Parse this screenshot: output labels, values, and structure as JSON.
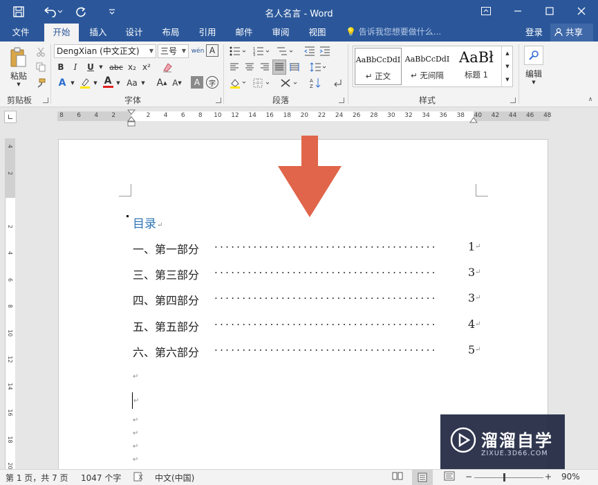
{
  "window": {
    "title": "名人名言 - Word"
  },
  "quick_access": {
    "save_icon": "save-icon",
    "undo_icon": "undo-icon",
    "redo_icon": "redo-icon",
    "customize_icon": "customize-qat-icon"
  },
  "window_controls": {
    "ribbon_display_icon": "ribbon-display-icon",
    "minimize_icon": "minimize-icon",
    "maximize_icon": "maximize-icon",
    "close_icon": "close-icon"
  },
  "tabs": [
    "文件",
    "开始",
    "插入",
    "设计",
    "布局",
    "引用",
    "邮件",
    "审阅",
    "视图"
  ],
  "active_tab": "开始",
  "tell_me": "告诉我您想要做什么...",
  "account": {
    "login": "登录",
    "share": "共享"
  },
  "ribbon": {
    "clipboard": {
      "label": "剪贴板",
      "paste": "粘贴"
    },
    "font": {
      "label": "字体",
      "font_name": "DengXian (中文正文)",
      "font_size": "三号",
      "phonetic_guide": "wén",
      "bold": "B",
      "italic": "I",
      "underline": "U",
      "strikethrough": "abc",
      "subscript": "x₂",
      "superscript": "x²",
      "change_case": "Aa",
      "grow_font": "A",
      "shrink_font": "A",
      "char_shading": "A",
      "enclose_char": "字"
    },
    "paragraph": {
      "label": "段落"
    },
    "styles": {
      "label": "样式",
      "items": [
        {
          "sample": "AaBbCcDdI",
          "name": "↵ 正文"
        },
        {
          "sample": "AaBbCcDdI",
          "name": "↵ 无间隔"
        },
        {
          "sample": "AaBł",
          "name": "标题 1"
        }
      ]
    },
    "editing": {
      "label": "编辑"
    }
  },
  "ruler": {
    "horizontal_numbers": [
      "8",
      "6",
      "4",
      "2",
      "",
      "2",
      "4",
      "6",
      "8",
      "10",
      "12",
      "14",
      "16",
      "18",
      "20",
      "22",
      "24",
      "26",
      "28",
      "30",
      "32",
      "34",
      "36",
      "38",
      "40",
      "42",
      "44",
      "46",
      "48"
    ],
    "vertical_numbers": [
      "4",
      "2",
      "",
      "2",
      "4",
      "6",
      "8",
      "10",
      "12",
      "14",
      "16",
      "18",
      "20"
    ]
  },
  "document": {
    "toc_title": "目录",
    "toc_entries": [
      {
        "text": "一、第一部分",
        "page": "1"
      },
      {
        "text": "三、第三部分",
        "page": "3"
      },
      {
        "text": "四、第四部分",
        "page": "3"
      },
      {
        "text": "五、第五部分",
        "page": "4"
      },
      {
        "text": "六、第六部分",
        "page": "5"
      }
    ],
    "paragraph_mark": "↵",
    "dot_leader": "........................................"
  },
  "status": {
    "page": "第 1 页，共 7 页",
    "words": "1047 个字",
    "language": "中文(中国)",
    "zoom": "90%"
  },
  "watermark": {
    "title": "溜溜自学",
    "subtitle": "ZIXUE.3D66.COM"
  },
  "colors": {
    "title_bar": "#2b579a",
    "toc_title": "#2e74b5",
    "arrow": "#e0654a"
  }
}
